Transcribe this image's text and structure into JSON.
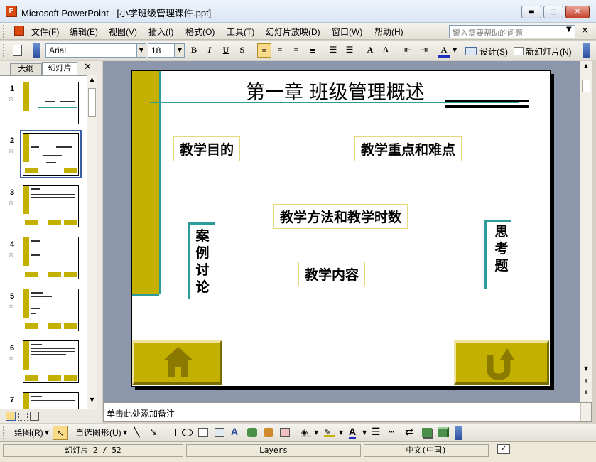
{
  "window": {
    "app_icon": "P",
    "title": "Microsoft PowerPoint - [小学班级管理课件.ppt]",
    "controls": {
      "minimize": "▬",
      "maximize": "□",
      "close": "✕"
    }
  },
  "menu": {
    "items": [
      "文件(F)",
      "编辑(E)",
      "视图(V)",
      "插入(I)",
      "格式(O)",
      "工具(T)",
      "幻灯片放映(D)",
      "窗口(W)",
      "帮助(H)"
    ],
    "help_placeholder": "键入需要帮助的问题"
  },
  "toolbar": {
    "font": "Arial",
    "size": "18",
    "bold": "B",
    "italic": "I",
    "underline": "U",
    "shadow": "S",
    "design_label": "设计(S)",
    "new_slide_label": "新幻灯片(N)"
  },
  "left_panel": {
    "tab_outline": "大纲",
    "tab_slides": "幻灯片",
    "close": "✕",
    "thumb_numbers": [
      "1",
      "2",
      "3",
      "4",
      "5",
      "6",
      "7"
    ]
  },
  "slide": {
    "title": "第一章  班级管理概述",
    "boxes": {
      "purpose": "教学目的",
      "focus": "教学重点和难点",
      "methods": "教学方法和教学时数",
      "content": "教学内容"
    },
    "vertical_left": [
      "案",
      "例",
      "讨",
      "论"
    ],
    "vertical_right": [
      "思",
      "考",
      "题"
    ]
  },
  "notes": {
    "placeholder": "单击此处添加备注"
  },
  "draw_toolbar": {
    "draw_label": "绘图(R)",
    "autoshape_label": "自选图形(U)"
  },
  "statusbar": {
    "slide_info": "幻灯片 2 / 52",
    "design": "Layers",
    "language": "中文(中国)"
  },
  "colors": {
    "accent": "#c4b000",
    "teal": "#2e9a9a",
    "workspace": "#8d97ab"
  }
}
